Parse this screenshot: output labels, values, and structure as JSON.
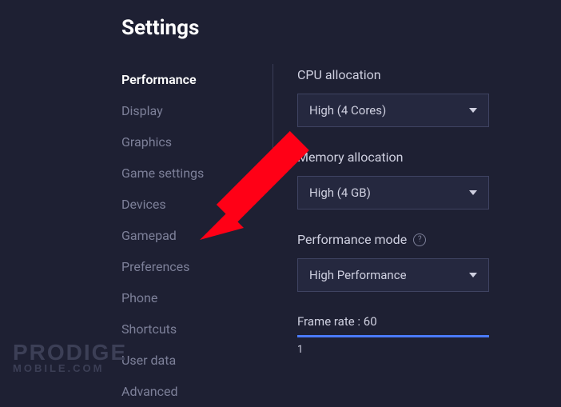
{
  "title": "Settings",
  "sidebar": {
    "items": [
      {
        "label": "Performance",
        "active": true
      },
      {
        "label": "Display"
      },
      {
        "label": "Graphics"
      },
      {
        "label": "Game settings"
      },
      {
        "label": "Devices"
      },
      {
        "label": "Gamepad"
      },
      {
        "label": "Preferences"
      },
      {
        "label": "Phone"
      },
      {
        "label": "Shortcuts"
      },
      {
        "label": "User data"
      },
      {
        "label": "Advanced"
      }
    ]
  },
  "panel": {
    "cpu": {
      "label": "CPU allocation",
      "value": "High (4 Cores)"
    },
    "memory": {
      "label": "Memory allocation",
      "value": "High (4 GB)"
    },
    "perf": {
      "label": "Performance mode",
      "value": "High Performance"
    },
    "frame": {
      "label": "Frame rate : 60",
      "tick": "1"
    }
  },
  "watermark": {
    "line1": "PRODIGE",
    "line2": "MOBILE.COM"
  }
}
